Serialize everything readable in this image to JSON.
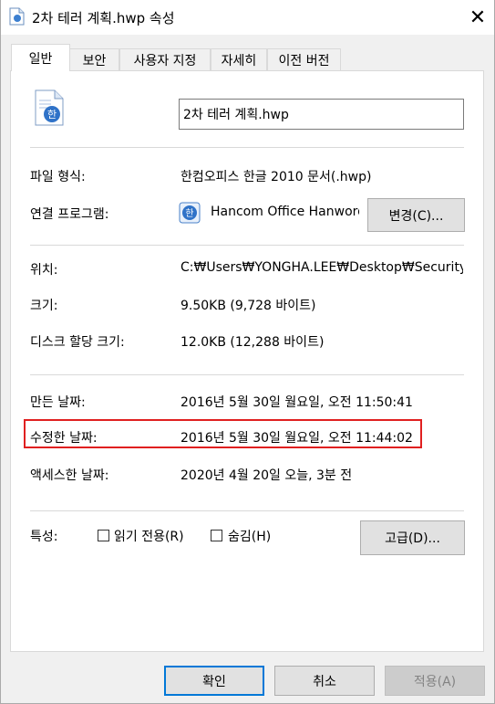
{
  "window": {
    "title": "2차 테러 계획.hwp 속성",
    "close_glyph": "✕"
  },
  "tabs": [
    {
      "label": "일반",
      "active": true
    },
    {
      "label": "보안",
      "active": false
    },
    {
      "label": "사용자 지정",
      "active": false
    },
    {
      "label": "자세히",
      "active": false
    },
    {
      "label": "이전 버전",
      "active": false
    }
  ],
  "general": {
    "filename": "2차 테러 계획.hwp",
    "file_type_label": "파일 형식:",
    "file_type_value": "한컴오피스 한글 2010 문서(.hwp)",
    "open_with_label": "연결 프로그램:",
    "open_with_value": "Hancom Office Hanword",
    "change_button": "변경(C)...",
    "location_label": "위치:",
    "location_value": "C:₩Users₩YONGHA.LEE₩Desktop₩Security-Study",
    "size_label": "크기:",
    "size_value": "9.50KB (9,728 바이트)",
    "size_on_disk_label": "디스크 할당 크기:",
    "size_on_disk_value": "12.0KB (12,288 바이트)",
    "created_label": "만든 날짜:",
    "created_value": "2016년 5월 30일 월요일, 오전 11:50:41",
    "modified_label": "수정한 날짜:",
    "modified_value": "2016년 5월 30일 월요일, 오전 11:44:02",
    "accessed_label": "액세스한 날짜:",
    "accessed_value": "2020년 4월 20일 오늘, 3분 전",
    "attributes_label": "특성:",
    "readonly_label": "읽기 전용(R)",
    "hidden_label": "숨김(H)",
    "advanced_button": "고급(D)..."
  },
  "footer": {
    "ok": "확인",
    "cancel": "취소",
    "apply": "적용(A)"
  },
  "colors": {
    "highlight": "#e02020",
    "accent": "#0078d7"
  }
}
